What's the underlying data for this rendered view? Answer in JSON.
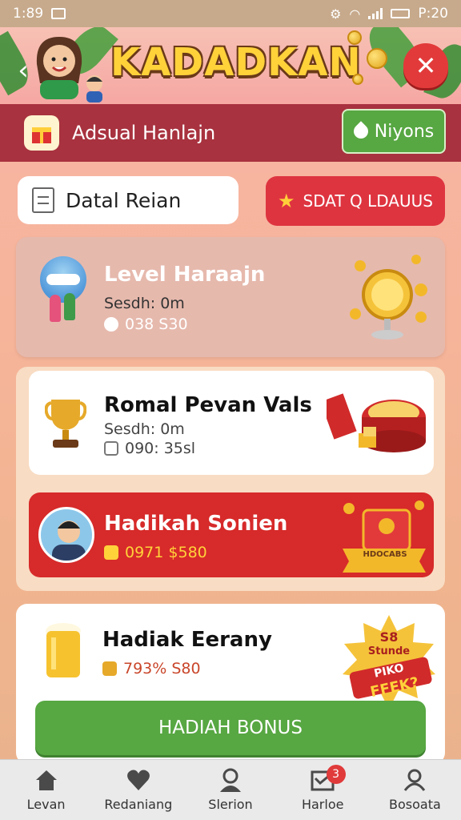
{
  "status_bar": {
    "time": "1:89",
    "right_text": "P:20"
  },
  "header": {
    "app_title": "KADADKAN",
    "close_label": "✕"
  },
  "subheader": {
    "title": "Adsual Hanlajn",
    "missions_label": "Niyons"
  },
  "tabs": {
    "detail_label": "Datal Reian",
    "start_label": "SDAT Q LDAUUS"
  },
  "cards": {
    "level": {
      "title": "Level Haraajn",
      "meta": "Sesdh: 0m",
      "value": "038 S30"
    },
    "reward": {
      "title": "Romal Pevan Vals",
      "meta": "Sesdh: 0m",
      "value": "090: 35sl"
    },
    "bonus": {
      "title": "Hadikah Sonien",
      "value": "0971 $580",
      "banner": "HDOCABS"
    },
    "daily": {
      "title": "Hadiak Eerany",
      "value": "793% S80",
      "badge_line1": "S8",
      "badge_line2": "Stunde",
      "badge_line3": "PIKO",
      "badge_line4": "FFEK?"
    }
  },
  "bonus_button": {
    "label": "HADIAH BONUS"
  },
  "bottom_nav": {
    "items": [
      {
        "label": "Levan",
        "icon": "home-icon"
      },
      {
        "label": "Redaniang",
        "icon": "heart-icon"
      },
      {
        "label": "Slerion",
        "icon": "person-icon"
      },
      {
        "label": "Harloe",
        "icon": "inbox-icon",
        "badge": "3"
      },
      {
        "label": "Bosoata",
        "icon": "profile-icon"
      }
    ]
  },
  "colors": {
    "accent_red": "#de3440",
    "accent_green": "#57a742",
    "title_yellow": "#ffd23a"
  }
}
